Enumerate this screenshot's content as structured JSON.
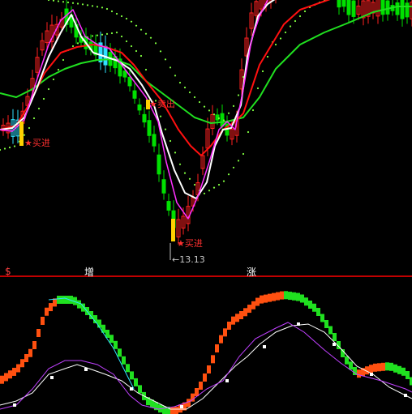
{
  "signals": {
    "buy_label": "买进",
    "sell_label": "卖出",
    "buy_label_2": "买进",
    "buy_marker": "★",
    "low_price": "←13.13"
  },
  "axis_labels": [
    "$",
    "增",
    "涨"
  ],
  "colors": {
    "background": "#000000",
    "up_candle": "#ff2020",
    "down_candle": "#00e000",
    "cyan_candle": "#30e0ff",
    "ma_fast": "#ffffff",
    "ma_magenta": "#ff30ff",
    "ma_red": "#ff1010",
    "ma_green": "#20e020",
    "band_dots": "#80ff40",
    "panel_divider": "#c00000",
    "osc_rising": "#ff5010",
    "osc_falling": "#20e020",
    "osc_line_white": "#ffffff",
    "osc_line_magenta": "#c040ff",
    "osc_line_cyan": "#30e0ff"
  }
}
